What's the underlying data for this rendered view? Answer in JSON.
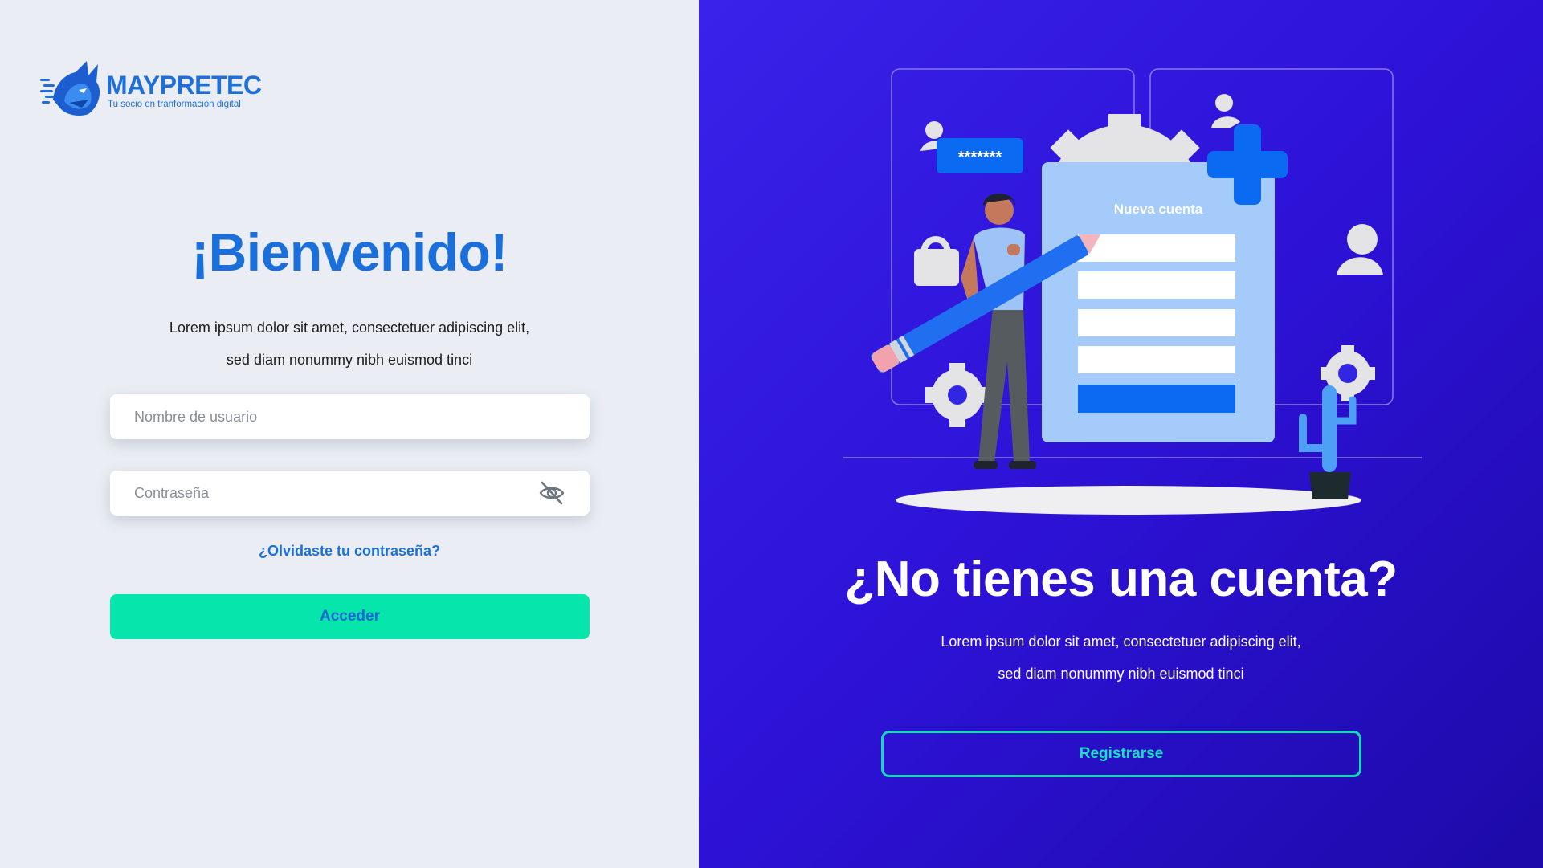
{
  "brand": {
    "name": "MAYPRETEC",
    "tagline": "Tu socio en tranformación digital",
    "logo_icon": "wolf-head-icon",
    "color": "#1f6fd9"
  },
  "login": {
    "title": "¡Bienvenido!",
    "description_line1": "Lorem ipsum dolor sit amet, consectetuer adipiscing elit,",
    "description_line2": "sed diam nonummy nibh euismod tinci",
    "username_placeholder": "Nombre de usuario",
    "password_placeholder": "Contraseña",
    "password_toggle_icon": "eye-off-icon",
    "forgot_label": "¿Olvidaste tu contraseña?",
    "submit_label": "Acceder",
    "submit_color": "#06e6ac"
  },
  "signup": {
    "title": "¿No tienes una cuenta?",
    "description_line1": "Lorem ipsum dolor sit amet, consectetuer adipiscing elit,",
    "description_line2": "sed diam nonummy nibh euismod tinci",
    "button_label": "Registrarse",
    "button_color": "#13d9b6",
    "panel_color": "#3a22ea"
  },
  "illustration": {
    "card_title": "Nueva cuenta",
    "password_bubble": "*******"
  }
}
